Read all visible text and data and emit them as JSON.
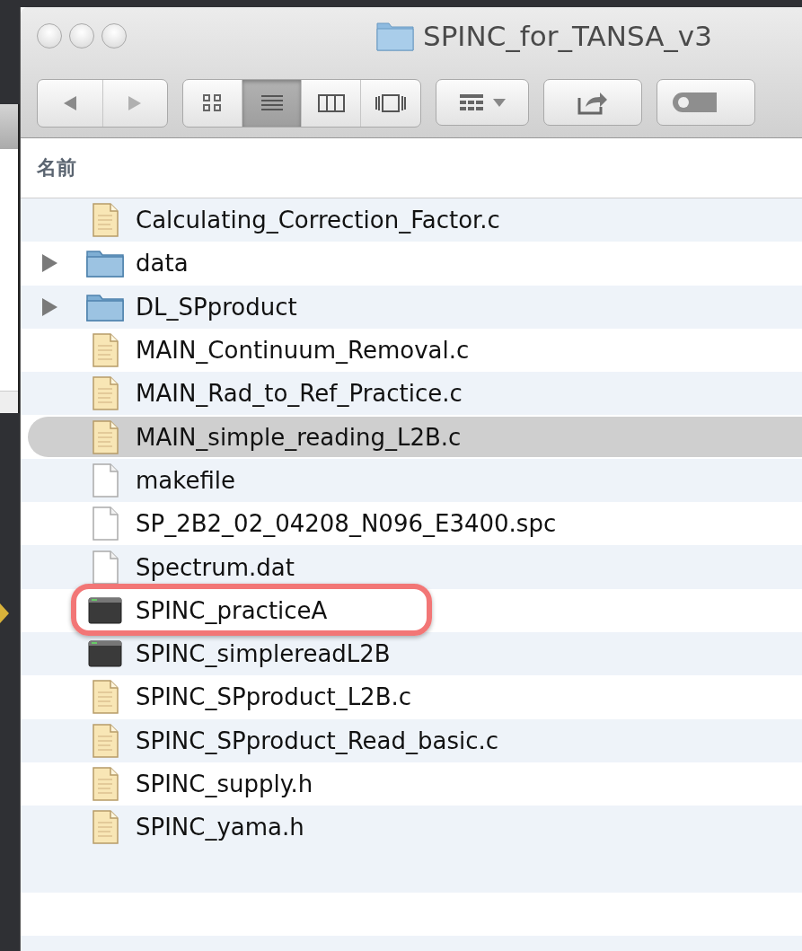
{
  "window": {
    "title": "SPINC_for_TANSA_v3"
  },
  "toolbar": {
    "views": [
      {
        "kind": "icons",
        "selected": false
      },
      {
        "kind": "list",
        "selected": true
      },
      {
        "kind": "columns",
        "selected": false
      },
      {
        "kind": "coverflow",
        "selected": false
      }
    ]
  },
  "header": {
    "column_1": "名前"
  },
  "files": [
    {
      "name": "Calculating_Correction_Factor.c",
      "kind": "source",
      "selected": false,
      "annotated": false
    },
    {
      "name": "data",
      "kind": "folder",
      "selected": false,
      "annotated": false
    },
    {
      "name": "DL_SPproduct",
      "kind": "folder",
      "selected": false,
      "annotated": false
    },
    {
      "name": "MAIN_Continuum_Removal.c",
      "kind": "source",
      "selected": false,
      "annotated": false
    },
    {
      "name": "MAIN_Rad_to_Ref_Practice.c",
      "kind": "source",
      "selected": false,
      "annotated": false
    },
    {
      "name": "MAIN_simple_reading_L2B.c",
      "kind": "source",
      "selected": true,
      "annotated": false
    },
    {
      "name": "makefile",
      "kind": "plain",
      "selected": false,
      "annotated": false
    },
    {
      "name": "SP_2B2_02_04208_N096_E3400.spc",
      "kind": "plain",
      "selected": false,
      "annotated": false
    },
    {
      "name": "Spectrum.dat",
      "kind": "plain",
      "selected": false,
      "annotated": false
    },
    {
      "name": "SPINC_practiceA",
      "kind": "executable",
      "selected": false,
      "annotated": true
    },
    {
      "name": "SPINC_simplereadL2B",
      "kind": "executable",
      "selected": false,
      "annotated": false
    },
    {
      "name": "SPINC_SPproduct_L2B.c",
      "kind": "source",
      "selected": false,
      "annotated": false
    },
    {
      "name": "SPINC_SPproduct_Read_basic.c",
      "kind": "source",
      "selected": false,
      "annotated": false
    },
    {
      "name": "SPINC_supply.h",
      "kind": "source",
      "selected": false,
      "annotated": false
    },
    {
      "name": "SPINC_yama.h",
      "kind": "source",
      "selected": false,
      "annotated": false
    }
  ]
}
